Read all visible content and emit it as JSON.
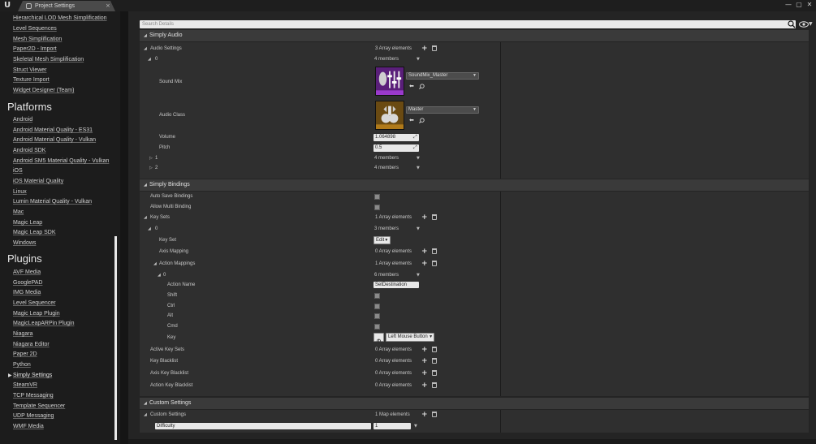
{
  "window": {
    "tab_title": "Project Settings",
    "controls": [
      "minimize",
      "maximize",
      "close"
    ]
  },
  "sidebar": {
    "top_items": [
      "Hierarchical LOD Mesh Simplification",
      "Level Sequences",
      "Mesh Simplification",
      "Paper2D - Import",
      "Skeletal Mesh Simplification",
      "Struct Viewer",
      "Texture Import",
      "Widget Designer (Team)"
    ],
    "platforms_header": "Platforms",
    "platforms": [
      "Android",
      "Android Material Quality - ES31",
      "Android Material Quality - Vulkan",
      "Android SDK",
      "Android SM5 Material Quality - Vulkan",
      "iOS",
      "iOS Material Quality",
      "Linux",
      "Lumin Material Quality - Vulkan",
      "Mac",
      "Magic Leap",
      "Magic Leap SDK",
      "Windows"
    ],
    "plugins_header": "Plugins",
    "plugins": [
      "AVF Media",
      "GooglePAD",
      "IMG Media",
      "Level Sequencer",
      "Magic Leap Plugin",
      "MagicLeapARPin Plugin",
      "Niagara",
      "Niagara Editor",
      "Paper 2D",
      "Python",
      "Simply Settings",
      "SteamVR",
      "TCP Messaging",
      "Template Sequencer",
      "UDP Messaging",
      "WMF Media"
    ],
    "active_item": "Simply Settings"
  },
  "search": {
    "placeholder": "Search Details"
  },
  "simply_audio": {
    "header": "Simply Audio",
    "audio_settings_label": "Audio Settings",
    "audio_settings_value": "3 Array elements",
    "element0_label": "0",
    "element0_value": "4 members",
    "sound_mix_label": "Sound Mix",
    "sound_mix_value": "SoundMix_Master",
    "audio_class_label": "Audio Class",
    "audio_class_value": "Master",
    "volume_label": "Volume",
    "volume_value": "1.064898",
    "pitch_label": "Pitch",
    "pitch_value": "0.5",
    "element1_label": "1",
    "element1_value": "4 members",
    "element2_label": "2",
    "element2_value": "4 members"
  },
  "simply_bindings": {
    "header": "Simply Bindings",
    "auto_save_label": "Auto Save Bindings",
    "auto_save_checked": false,
    "allow_multi_label": "Allow Multi Binding",
    "allow_multi_checked": false,
    "key_sets_label": "Key Sets",
    "key_sets_value": "1 Array elements",
    "ks0_label": "0",
    "ks0_value": "3 members",
    "key_set_label": "Key Set",
    "key_set_value": "Edit",
    "axis_mapping_label": "Axis Mapping",
    "axis_mapping_value": "0 Array elements",
    "action_mappings_label": "Action Mappings",
    "action_mappings_value": "1 Array elements",
    "am0_label": "0",
    "am0_value": "6 members",
    "action_name_label": "Action Name",
    "action_name_value": "SetDestination",
    "shift_label": "Shift",
    "ctrl_label": "Ctrl",
    "alt_label": "Alt",
    "cmd_label": "Cmd",
    "key_label": "Key",
    "key_value": "Left Mouse Button",
    "active_key_sets_label": "Active Key Sets",
    "active_key_sets_value": "0 Array elements",
    "key_blacklist_label": "Key Blacklist",
    "key_blacklist_value": "0 Array elements",
    "axis_key_blacklist_label": "Axis Key Blacklist",
    "axis_key_blacklist_value": "0 Array elements",
    "action_key_blacklist_label": "Action Key Blacklist",
    "action_key_blacklist_value": "0 Array elements"
  },
  "custom_settings": {
    "header": "Custom Settings",
    "label": "Custom Settings",
    "value": "1 Map elements",
    "key_field": "Difficulty",
    "value_field": "1"
  },
  "colors": {
    "background": "#242424",
    "sidebar": "#1c1c1c",
    "category": "#3a3a3a",
    "sound_mix_thumb": "#5a1f7a",
    "audio_class_thumb": "#6a4a12"
  }
}
